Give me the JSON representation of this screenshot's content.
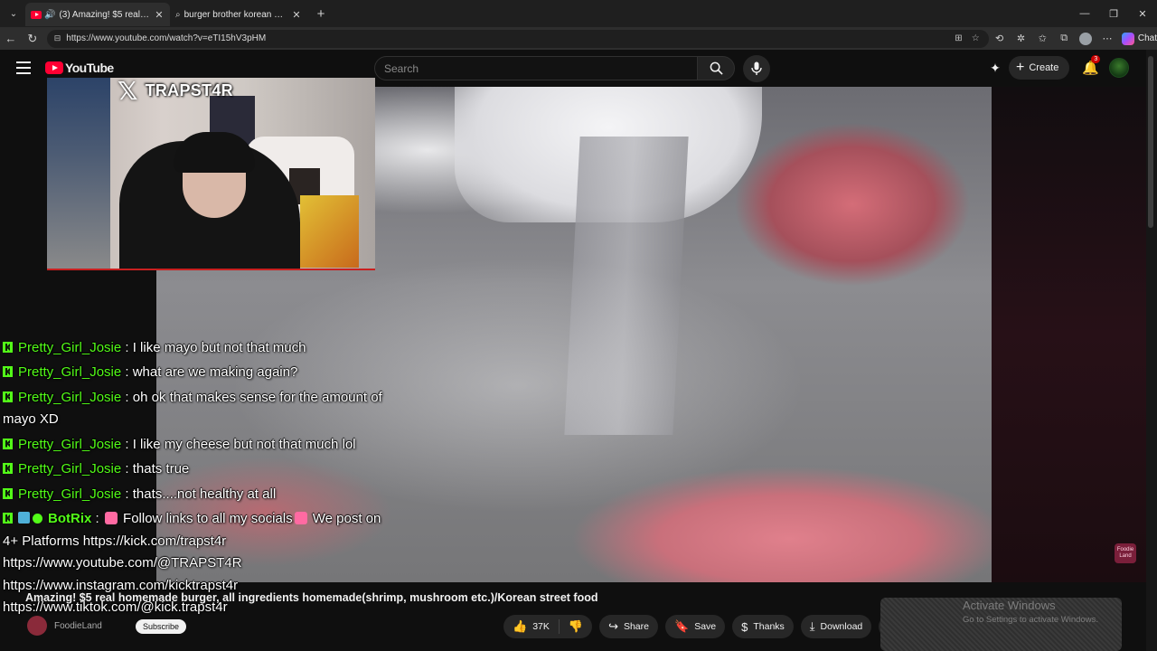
{
  "browser": {
    "tabs": [
      {
        "title": "(3) Amazing! $5 real homemade burger",
        "active": true
      },
      {
        "title": "burger brother korean street food",
        "active": false
      }
    ],
    "url": "https://www.youtube.com/watch?v=eTI15hV3pHM",
    "chat_button": "Chat"
  },
  "youtube": {
    "logo_text": "YouTube",
    "search_placeholder": "Search",
    "create_label": "Create",
    "notification_count": "3"
  },
  "stream_overlay": {
    "handle": "TRAPST4R"
  },
  "chat": {
    "messages": [
      {
        "user": "Pretty_Girl_Josie",
        "text": " : I like mayo but not that much"
      },
      {
        "user": "Pretty_Girl_Josie",
        "text": " : what are we making again?"
      },
      {
        "user": "Pretty_Girl_Josie",
        "text": " : oh ok that makes sense for the amount of mayo XD"
      },
      {
        "user": "Pretty_Girl_Josie",
        "text": " : I like my cheese but not that much lol"
      },
      {
        "user": "Pretty_Girl_Josie",
        "text": " : thats true"
      },
      {
        "user": "Pretty_Girl_Josie",
        "text": " : thats....not healthy at all"
      }
    ],
    "bot": {
      "user": "BotRix",
      "text_a": " Follow links to all my socials",
      "text_b": " We post on 4+ Platforms https://kick.com/trapst4r",
      "links": [
        "https://www.youtube.com/@TRAPST4R",
        "https://www.instagram.com/kicktrapst4r",
        "https://www.tiktok.com/@kick.trapst4r"
      ]
    }
  },
  "video": {
    "title": "Amazing! $5 real homemade burger, all ingredients homemade(shrimp, mushroom etc.)/Korean street food",
    "channel": "FoodieLand",
    "subscribe_label": "Subscribe",
    "likes": "37K",
    "share_label": "Share",
    "save_label": "Save",
    "thanks_label": "Thanks",
    "download_label": "Download",
    "watermark": "Foodie Land"
  },
  "windows_watermark": {
    "line1": "Activate Windows",
    "line2": "Go to Settings to activate Windows."
  },
  "colors": {
    "kick_green": "#53fc18",
    "youtube_red": "#ff0033",
    "background": "#0f0f0f"
  }
}
